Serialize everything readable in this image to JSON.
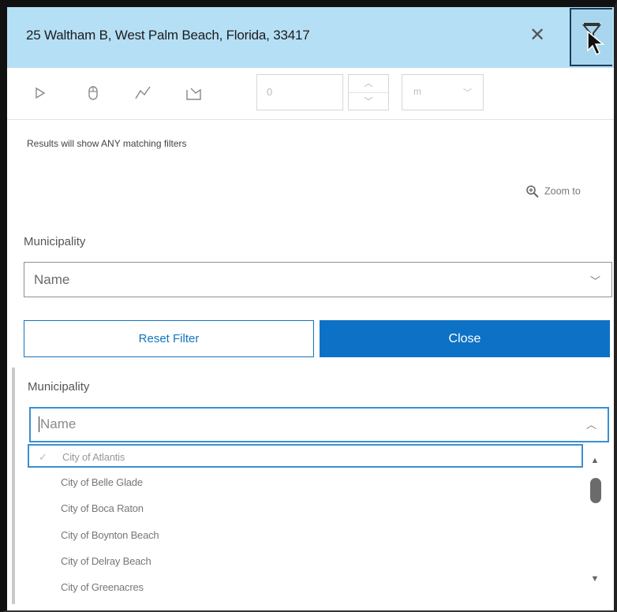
{
  "header": {
    "title": "25 Waltham B, West Palm Beach, Florida, 33417",
    "close_icon": "close-icon",
    "filter_icon": "filter-icon"
  },
  "toolbar": {
    "tools": [
      "play-icon",
      "mouse-icon",
      "polyline-icon",
      "polygon-icon"
    ],
    "distance_value": "0",
    "unit_value": "m"
  },
  "filter_panel": {
    "results_note": "Results will show ANY matching filters",
    "zoom_to_label": "Zoom to",
    "municipality_label": "Municipality",
    "municipality_value": "Name",
    "reset_label": "Reset Filter",
    "close_label": "Close"
  },
  "dropdown": {
    "label": "Municipality",
    "input_placeholder": "Name",
    "options": [
      "City of Atlantis",
      "City of Belle Glade",
      "City of Boca Raton",
      "City of Boynton Beach",
      "City of Delray Beach",
      "City of Greenacres"
    ]
  },
  "colors": {
    "header_bg": "#b5dff5",
    "primary": "#0d72c5",
    "focus_border": "#3b8fd1"
  }
}
